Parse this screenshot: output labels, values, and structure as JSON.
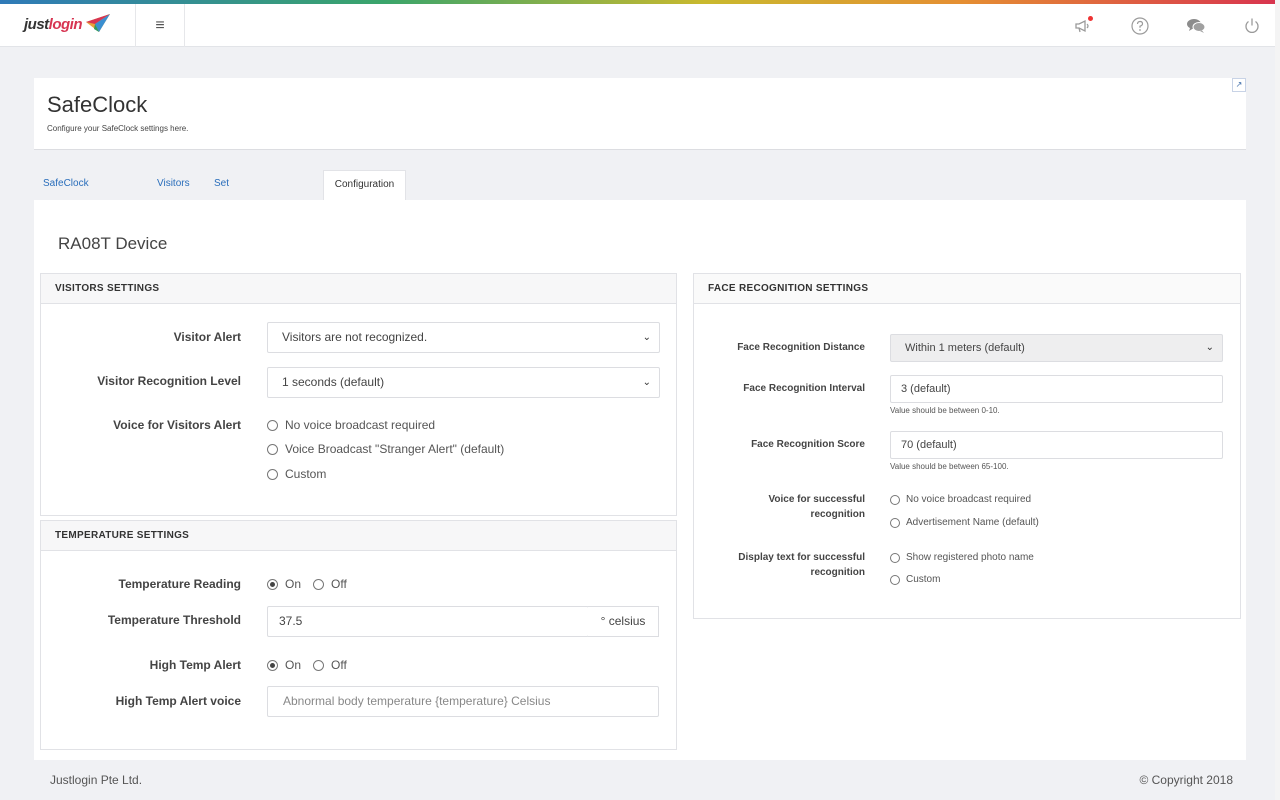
{
  "app": {
    "logo_part1": "just",
    "logo_part2": "login",
    "menu_icon": "hamburger-icon",
    "icons": [
      "megaphone-icon",
      "help-icon",
      "chat-icon",
      "power-icon"
    ],
    "colors": {
      "accent": "#2a6ebb",
      "brand_red": "#d73552",
      "notification": "#e33333"
    }
  },
  "header": {
    "title": "SafeClock",
    "subtitle": "Configure your SafeClock settings here.",
    "expand_glyph": "↗"
  },
  "tabs": [
    {
      "label": "SafeClock Summary"
    },
    {
      "label": "Visitors"
    },
    {
      "label": "Set Reference Photos"
    },
    {
      "label": "Configuration",
      "active": true
    }
  ],
  "device_title": "RA08T Device",
  "visitors": {
    "heading": "VISITORS SETTINGS",
    "alert_label": "Visitor Alert",
    "alert_value": "Visitors are not recognized.",
    "level_label": "Visitor Recognition Level",
    "level_value": "1 seconds (default)",
    "voice_label": "Voice for Visitors Alert",
    "voice_options": [
      "No voice broadcast required",
      "Voice Broadcast \"Stranger Alert\" (default)",
      "Custom"
    ]
  },
  "temperature": {
    "heading": "TEMPERATURE SETTINGS",
    "reading_label": "Temperature Reading",
    "reading_on": "On",
    "reading_off": "Off",
    "reading_selected": "On",
    "threshold_label": "Temperature Threshold",
    "threshold_value": "37.5",
    "threshold_unit": "° celsius",
    "high_label": "High Temp Alert",
    "high_on": "On",
    "high_off": "Off",
    "high_selected": "On",
    "voice_label": "High Temp Alert voice",
    "voice_placeholder": "Abnormal body temperature {temperature} Celsius"
  },
  "face": {
    "heading": "FACE RECOGNITION SETTINGS",
    "distance_label": "Face Recognition Distance",
    "distance_value": "Within 1 meters (default)",
    "interval_label": "Face Recognition Interval",
    "interval_value": "3 (default)",
    "interval_hint": "Value should be between 0-10.",
    "score_label": "Face Recognition Score",
    "score_value": "70 (default)",
    "score_hint": "Value should be between 65-100.",
    "voice_label_1": "Voice for successful",
    "voice_label_2": "recognition",
    "voice_options": [
      "No voice broadcast required",
      "Advertisement Name (default)"
    ],
    "display_label_1": "Display text for successful",
    "display_label_2": "recognition",
    "display_options": [
      "Show registered photo name",
      "Custom"
    ]
  },
  "footer": {
    "company": "Justlogin Pte Ltd.",
    "copyright": "© Copyright 2018"
  }
}
